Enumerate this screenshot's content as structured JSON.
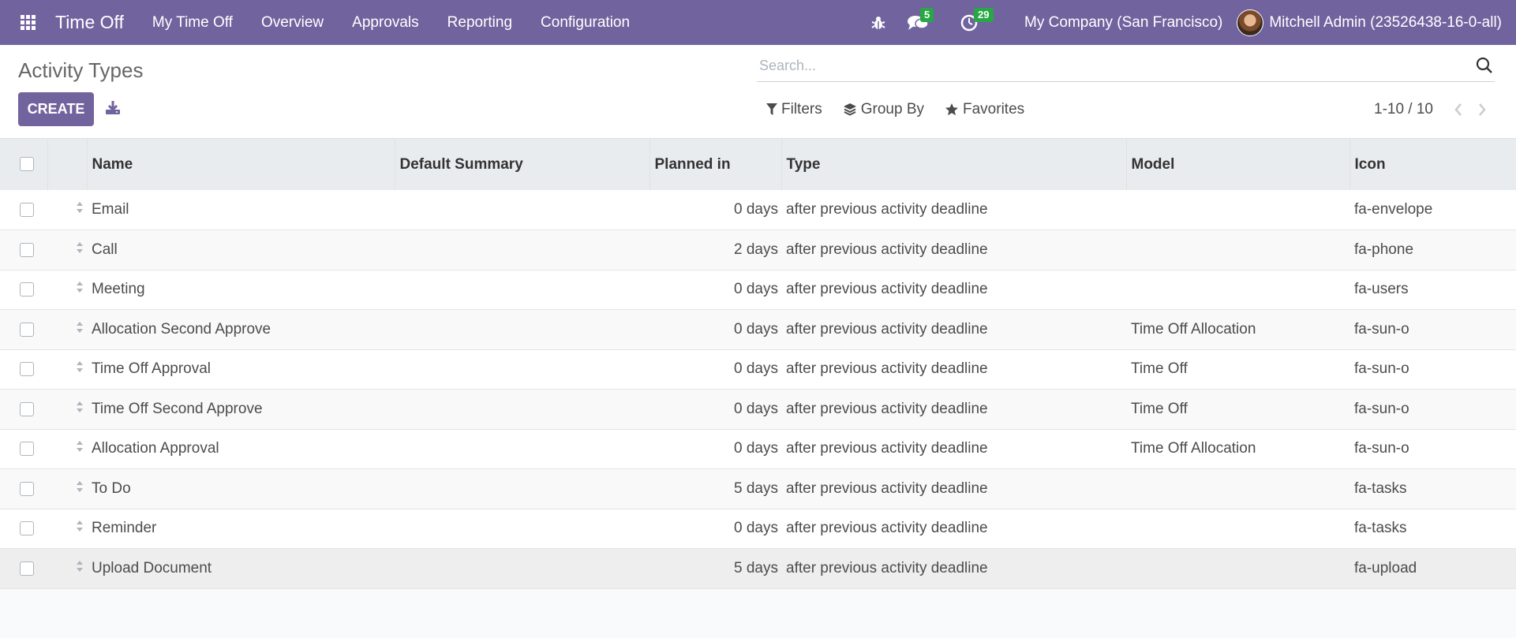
{
  "navbar": {
    "app_title": "Time Off",
    "menu": [
      {
        "label": "My Time Off"
      },
      {
        "label": "Overview"
      },
      {
        "label": "Approvals"
      },
      {
        "label": "Reporting"
      },
      {
        "label": "Configuration"
      }
    ],
    "messages_count": "5",
    "activities_count": "29",
    "company": "My Company (San Francisco)",
    "user": "Mitchell Admin (23526438-16-0-all)"
  },
  "control": {
    "page_title": "Activity Types",
    "create_label": "CREATE",
    "search_placeholder": "Search...",
    "filters_label": "Filters",
    "group_by_label": "Group By",
    "favorites_label": "Favorites",
    "pager_value": "1-10 / 10"
  },
  "table": {
    "columns": {
      "name": "Name",
      "default_summary": "Default Summary",
      "planned_in": "Planned in",
      "type": "Type",
      "model": "Model",
      "icon": "Icon"
    },
    "rows": [
      {
        "name": "Email",
        "summary": "",
        "planned": "0 days",
        "type": "after previous activity deadline",
        "model": "",
        "icon": "fa-envelope"
      },
      {
        "name": "Call",
        "summary": "",
        "planned": "2 days",
        "type": "after previous activity deadline",
        "model": "",
        "icon": "fa-phone"
      },
      {
        "name": "Meeting",
        "summary": "",
        "planned": "0 days",
        "type": "after previous activity deadline",
        "model": "",
        "icon": "fa-users"
      },
      {
        "name": "Allocation Second Approve",
        "summary": "",
        "planned": "0 days",
        "type": "after previous activity deadline",
        "model": "Time Off Allocation",
        "icon": "fa-sun-o"
      },
      {
        "name": "Time Off Approval",
        "summary": "",
        "planned": "0 days",
        "type": "after previous activity deadline",
        "model": "Time Off",
        "icon": "fa-sun-o"
      },
      {
        "name": "Time Off Second Approve",
        "summary": "",
        "planned": "0 days",
        "type": "after previous activity deadline",
        "model": "Time Off",
        "icon": "fa-sun-o"
      },
      {
        "name": "Allocation Approval",
        "summary": "",
        "planned": "0 days",
        "type": "after previous activity deadline",
        "model": "Time Off Allocation",
        "icon": "fa-sun-o"
      },
      {
        "name": "To Do",
        "summary": "",
        "planned": "5 days",
        "type": "after previous activity deadline",
        "model": "",
        "icon": "fa-tasks"
      },
      {
        "name": "Reminder",
        "summary": "",
        "planned": "0 days",
        "type": "after previous activity deadline",
        "model": "",
        "icon": "fa-tasks"
      },
      {
        "name": "Upload Document",
        "summary": "",
        "planned": "5 days",
        "type": "after previous activity deadline",
        "model": "",
        "icon": "fa-upload"
      }
    ]
  },
  "colors": {
    "brand": "#71639e",
    "badge": "#28a745"
  }
}
